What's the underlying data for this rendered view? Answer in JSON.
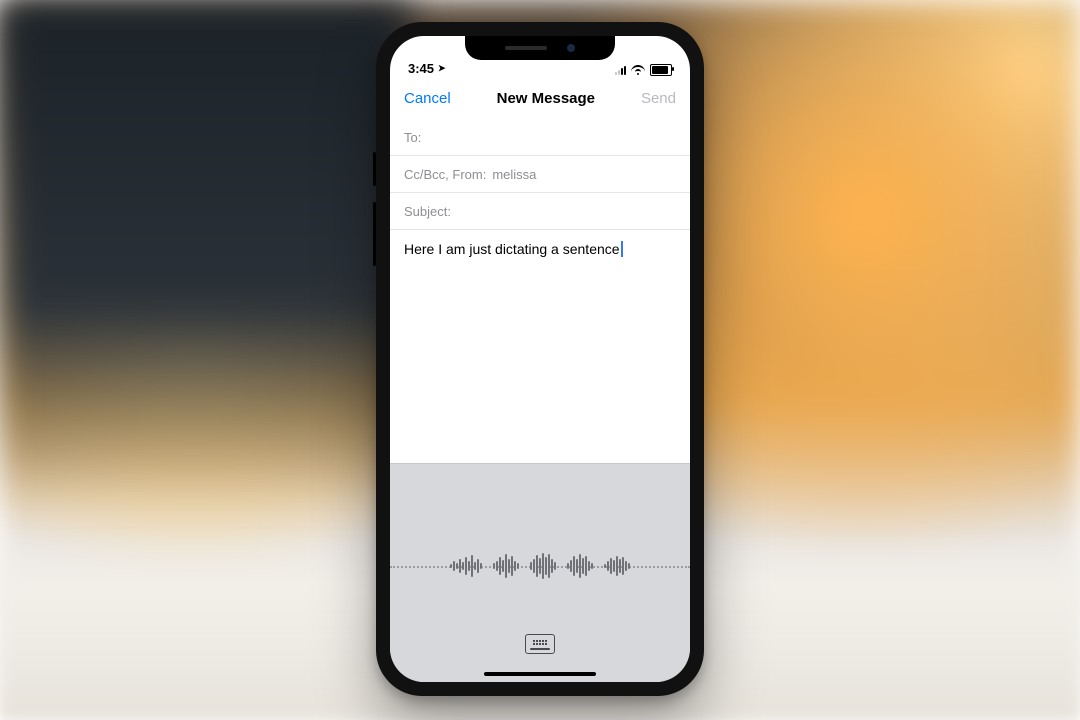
{
  "status": {
    "time": "3:45",
    "location_arrow": "➤"
  },
  "nav": {
    "cancel": "Cancel",
    "title": "New Message",
    "send": "Send"
  },
  "fields": {
    "to_label": "To:",
    "to_value": "",
    "ccbcc_label": "Cc/Bcc, From:",
    "ccbcc_value": "melissa",
    "subject_label": "Subject:",
    "subject_value": ""
  },
  "body": {
    "text": "Here I am just dictating a sentence"
  },
  "dictation": {
    "waveform": [
      4,
      10,
      6,
      14,
      8,
      18,
      10,
      22,
      8,
      14,
      6,
      0,
      0,
      6,
      10,
      18,
      12,
      24,
      14,
      20,
      10,
      6,
      0,
      0,
      8,
      14,
      22,
      16,
      26,
      18,
      24,
      14,
      8,
      0,
      0,
      6,
      12,
      20,
      14,
      24,
      16,
      20,
      10,
      6,
      0,
      0,
      4,
      10,
      16,
      12,
      20,
      14,
      18,
      10,
      6
    ],
    "keyboard_label": "keyboard"
  }
}
